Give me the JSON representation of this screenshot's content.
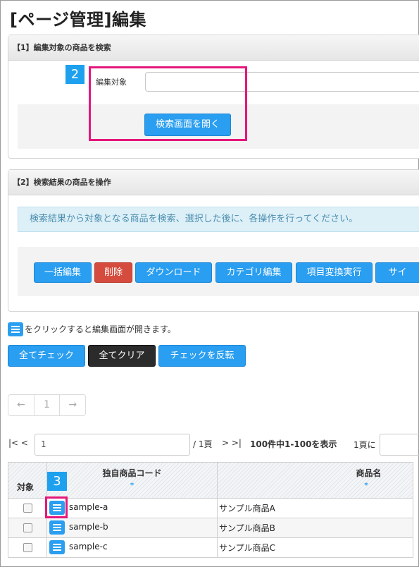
{
  "page": {
    "title": "[ページ管理]編集"
  },
  "search_panel": {
    "header": "【1】編集対象の商品を検索",
    "field_label": "編集対象",
    "field_value": "",
    "open_button": "検索画面を開く",
    "badge": "2"
  },
  "operate_panel": {
    "header": "【2】検索結果の商品を操作",
    "info": "検索結果から対象となる商品を検索、選択した後に、各操作を行ってください。",
    "buttons": [
      "一括編集",
      "削除",
      "ダウンロード",
      "カテゴリ編集",
      "項目変換実行",
      "サイ"
    ]
  },
  "hint": {
    "text": "をクリックすると編集画面が開きます。",
    "icon": "edit-list-icon"
  },
  "check_buttons": {
    "check_all": "全てチェック",
    "clear_all": "全てクリア",
    "invert": "チェックを反転"
  },
  "pager": {
    "prev": "←",
    "current": "1",
    "next": "→"
  },
  "page_nav": {
    "first": "|< <",
    "page_value": "1",
    "total": "/ 1頁",
    "next_last": "> >|",
    "range": "100件中1-100を表示",
    "goto_label": "1頁に"
  },
  "table": {
    "badge": "3",
    "headers": {
      "select": "対象",
      "code": "独自商品コード",
      "name": "商品名",
      "sort_mark": "*"
    },
    "rows": [
      {
        "code": "sample-a",
        "name": "サンプル商品A"
      },
      {
        "code": "sample-b",
        "name": "サンプル商品B"
      },
      {
        "code": "sample-c",
        "name": "サンプル商品C"
      }
    ]
  },
  "colors": {
    "accent": "#2a9ef0",
    "highlight": "#e5177b",
    "danger": "#d54b3d",
    "info_bg": "#def0f7"
  }
}
